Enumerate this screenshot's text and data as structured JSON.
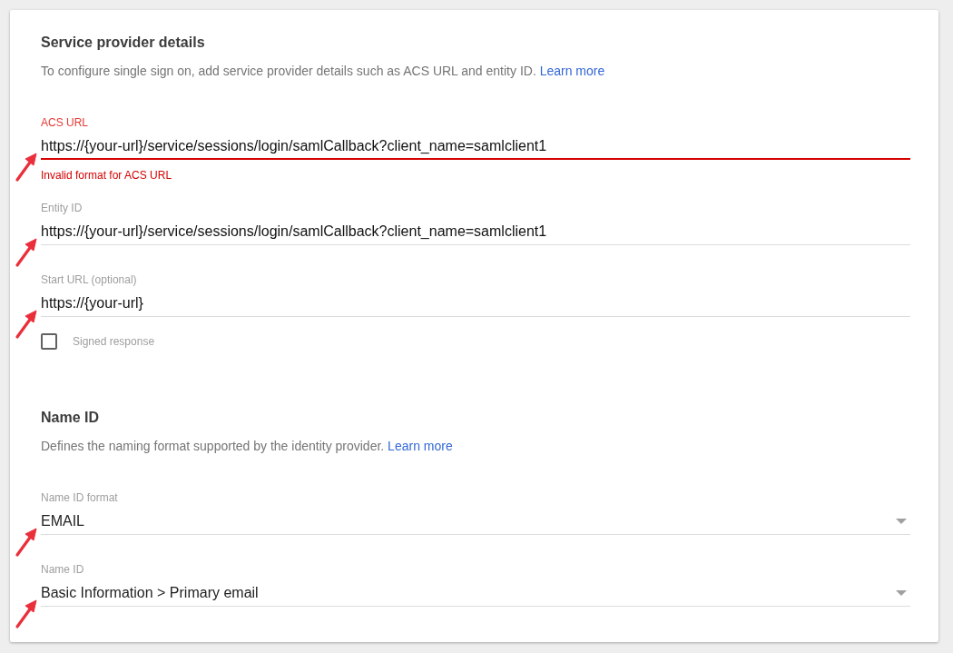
{
  "sections": [
    {
      "title": "Service provider details",
      "description": "To configure single sign on, add service provider details such as ACS URL and entity ID.",
      "link": "Learn more",
      "fields": [
        {
          "kind": "text",
          "label": "ACS URL",
          "value": "https://{your-url}/service/sessions/login/samlCallback?client_name=samlclient1",
          "invalid": true,
          "error": "Invalid format for ACS URL",
          "marked": true
        },
        {
          "kind": "text",
          "label": "Entity ID",
          "value": "https://{your-url}/service/sessions/login/samlCallback?client_name=samlclient1",
          "invalid": false,
          "marked": true
        },
        {
          "kind": "text",
          "label": "Start URL (optional)",
          "value": "https://{your-url}",
          "invalid": false,
          "marked": true
        },
        {
          "kind": "checkbox",
          "label": "Signed response",
          "checked": false
        }
      ]
    },
    {
      "title": "Name ID",
      "description": "Defines the naming format supported by the identity provider.",
      "link": "Learn more",
      "fields": [
        {
          "kind": "select",
          "label": "Name ID format",
          "value": "EMAIL",
          "marked": true
        },
        {
          "kind": "select",
          "label": "Name ID",
          "value": "Basic Information > Primary email",
          "marked": true
        }
      ]
    }
  ]
}
